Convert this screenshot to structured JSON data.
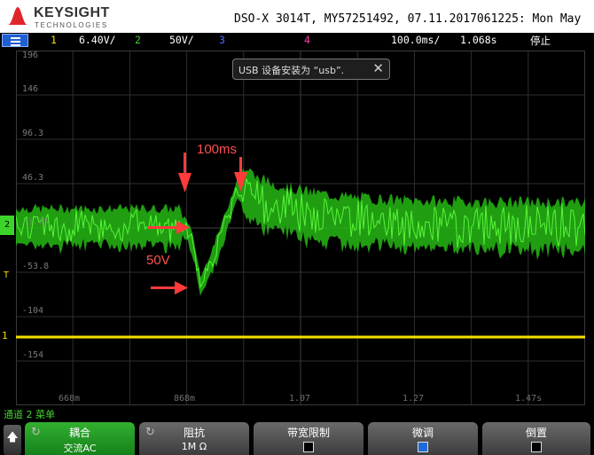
{
  "header": {
    "brand": "KEYSIGHT",
    "brand_sub": "TECHNOLOGIES",
    "model_line": "DSO-X 3014T, MY57251492, 07.11.2017061225: Mon May"
  },
  "status_bar": {
    "ch1_num": "1",
    "ch1_scale": "6.40V/",
    "ch2_num": "2",
    "ch2_scale": "50V/",
    "ch3_num": "3",
    "ch4_num": "4",
    "timebase": "100.0ms/",
    "delay": "1.068s",
    "run_state": "停止"
  },
  "screen": {
    "y_labels": [
      "196",
      "146",
      "96.3",
      "46.3",
      "-3.75",
      "-53.8",
      "-104",
      "-154"
    ],
    "x_labels": [
      "668m",
      "868m",
      "1.07",
      "1.27",
      "1.47s"
    ],
    "ch2_marker": "2",
    "trigger_marker": "T",
    "ch1_marker": "1"
  },
  "annotations": {
    "time_label": "100ms",
    "voltage_label": "50V"
  },
  "toast": {
    "message": "USB 设备安装为 “usb”.",
    "close_icon": "close-icon"
  },
  "channel_menu": {
    "title": "通道 2 菜单"
  },
  "softkeys": [
    {
      "label": "耦合",
      "value": "交流AC",
      "active": true
    },
    {
      "label": "阻抗",
      "value": "1M Ω",
      "active": false
    },
    {
      "label": "带宽限制",
      "checked": false
    },
    {
      "label": "微调",
      "checked": true
    },
    {
      "label": "倒置",
      "checked": false
    }
  ],
  "colors": {
    "ch1": "#f5e000",
    "ch2": "#3ad42a",
    "ch3": "#4f6bff",
    "ch4": "#ff3fa0",
    "annotation": "#ff3b3b",
    "menu_button": "#1f5fd1"
  }
}
